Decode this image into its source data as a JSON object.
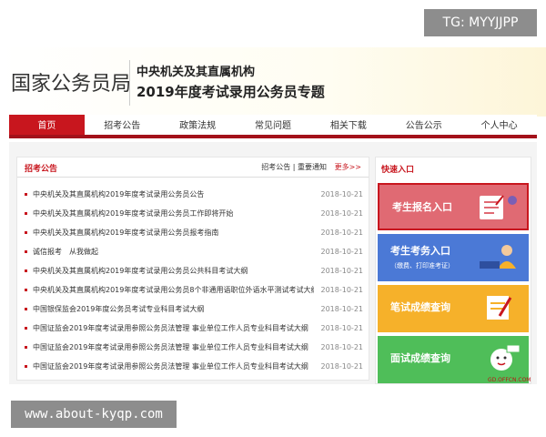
{
  "badge_tg": "TG: MYYJJPP",
  "header": {
    "site_name": "国家公务员局",
    "subtitle1": "中央机关及其直属机构",
    "subtitle2": "2019年度考试录用公务员专题"
  },
  "nav": [
    {
      "label": "首页",
      "active": true
    },
    {
      "label": "招考公告"
    },
    {
      "label": "政策法规"
    },
    {
      "label": "常见问题"
    },
    {
      "label": "相关下载"
    },
    {
      "label": "公告公示"
    },
    {
      "label": "个人中心"
    }
  ],
  "announcements": {
    "title": "招考公告",
    "links": "招考公告 | 重要通知",
    "more": "更多>>",
    "items": [
      {
        "title": "中央机关及其直属机构2019年度考试录用公务员公告",
        "date": "2018-10-21"
      },
      {
        "title": "中央机关及其直属机构2019年度考试录用公务员工作即将开始",
        "date": "2018-10-21"
      },
      {
        "title": "中央机关及其直属机构2019年度考试录用公务员报考指南",
        "date": "2018-10-21"
      },
      {
        "title": "诚信报考　从我做起",
        "date": "2018-10-21"
      },
      {
        "title": "中央机关及其直属机构2019年度考试录用公务员公共科目考试大纲",
        "date": "2018-10-21"
      },
      {
        "title": "中央机关及其直属机构2019年度考试录用公务员8个非通用语职位外语水平测试考试大纲",
        "date": "2018-10-21"
      },
      {
        "title": "中国银保监会2019年度公务员考试专业科目考试大纲",
        "date": "2018-10-21"
      },
      {
        "title": "中国证监会2019年度考试录用参照公务员法管理 事业单位工作人员专业科目考试大纲",
        "date": "2018-10-21"
      },
      {
        "title": "中国证监会2019年度考试录用参照公务员法管理 事业单位工作人员专业科目考试大纲",
        "date": "2018-10-21"
      },
      {
        "title": "中国证监会2019年度考试录用参照公务员法管理 事业单位工作人员专业科目考试大纲",
        "date": "2018-10-21"
      }
    ]
  },
  "quick": {
    "title": "快速入口",
    "btn1": "考生报名入口",
    "btn2": "考生考务入口",
    "btn2_sub": "（缴费、打印准考证）",
    "btn3": "笔试成绩查询",
    "btn4": "面试成绩查询"
  },
  "watermark": "GD.OFFCN.COM",
  "badge_url": "www.about-kyqp.com",
  "colors": {
    "brand_red": "#c8161e",
    "blue": "#4b79d6",
    "orange": "#f6b12a",
    "green": "#4fbe59"
  }
}
